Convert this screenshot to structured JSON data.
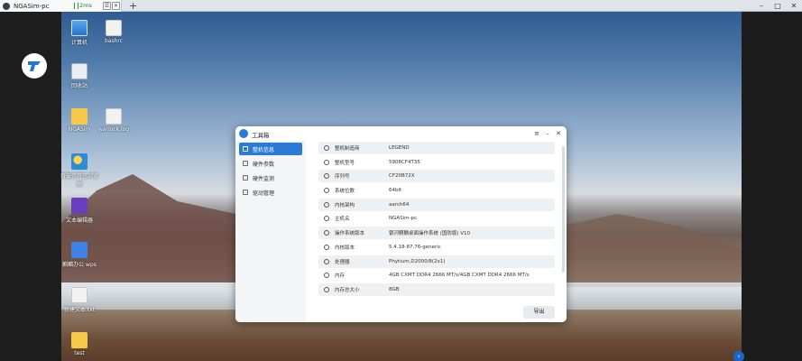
{
  "tab": {
    "title": "NGASim-pc",
    "ping": "2ms"
  },
  "desktop_icons": {
    "computer": "计算机",
    "bashrc": "bashrc",
    "trash": "回收站",
    "ngasim_folder": "NGASim",
    "warlock": "warlock.log",
    "browser": "奇安信可信浏览器",
    "editor": "文本编辑器",
    "wps": "麒麟办公 wps",
    "new_doc": "新建文本.txt",
    "test_folder": "test"
  },
  "tool": {
    "title": "工具箱",
    "nav": [
      "整机信息",
      "硬件参数",
      "硬件监测",
      "驱动管理"
    ],
    "rows": [
      {
        "label": "整机制造商",
        "value": "LEGEND"
      },
      {
        "label": "整机型号",
        "value": "5908CF4T35"
      },
      {
        "label": "序列号",
        "value": "CF20B72X"
      },
      {
        "label": "系统位数",
        "value": "64bit"
      },
      {
        "label": "内核架构",
        "value": "aarch64"
      },
      {
        "label": "主机名",
        "value": "NGASim-pc"
      },
      {
        "label": "操作系统版本",
        "value": "银河麒麟桌面操作系统 (国防版) V10"
      },
      {
        "label": "内核版本",
        "value": "5.4.18-87.76-generic"
      },
      {
        "label": "处理器",
        "value": "Phytium,D2000/8(2x1)"
      },
      {
        "label": "内存",
        "value": "4GB CXMT DDR4 2666 MT/s/4GB CXMT DDR4 2666 MT/s"
      },
      {
        "label": "内存总大小",
        "value": "8GB"
      }
    ],
    "export_label": "导出"
  }
}
